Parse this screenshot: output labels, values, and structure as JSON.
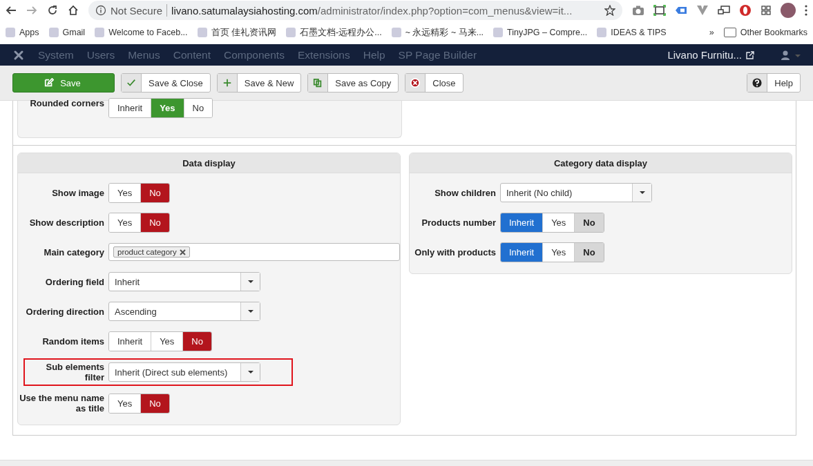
{
  "browser": {
    "security": "Not Secure",
    "url_host": "livano.satumalaysiahosting.com",
    "url_path": "/administrator/index.php?option=com_menus&view=it...",
    "bookmarks": [
      {
        "label": "Apps"
      },
      {
        "label": "Gmail"
      },
      {
        "label": "Welcome to Faceb..."
      },
      {
        "label": "首页 佳礼资讯网"
      },
      {
        "label": "石墨文档-远程办公..."
      },
      {
        "label": "~ 永远精彩 ~ 马来..."
      },
      {
        "label": "TinyJPG – Compre..."
      },
      {
        "label": "IDEAS & TIPS"
      }
    ],
    "overflow": "»",
    "other_bookmarks": "Other Bookmarks"
  },
  "nav": {
    "menu": [
      "System",
      "Users",
      "Menus",
      "Content",
      "Components",
      "Extensions",
      "Help",
      "SP Page Builder"
    ],
    "site_link": "Livano Furnitu..."
  },
  "toolbar": [
    {
      "label": "Save",
      "kind": "save"
    },
    {
      "label": "Save & Close",
      "kind": "check"
    },
    {
      "label": "Save & New",
      "kind": "plus"
    },
    {
      "label": "Save as Copy",
      "kind": "copy"
    },
    {
      "label": "Close",
      "kind": "close"
    }
  ],
  "help_button": "Help",
  "top_panel": {
    "fields": [
      {
        "label": "Rounded corners",
        "kind": "toggle",
        "options": [
          {
            "label": "Inherit",
            "kind": "inherit",
            "selected": false,
            "pressed": false
          },
          {
            "label": "Yes",
            "kind": "yes",
            "selected": true,
            "pressed": false
          },
          {
            "label": "No",
            "kind": "no",
            "selected": false,
            "pressed": false
          }
        ]
      }
    ]
  },
  "panels": [
    {
      "title": "Data display",
      "fields": [
        {
          "label": "Show image",
          "kind": "toggle",
          "options": [
            {
              "label": "Yes",
              "kind": "yes",
              "selected": false,
              "pressed": false
            },
            {
              "label": "No",
              "kind": "no",
              "selected": true,
              "pressed": false
            }
          ]
        },
        {
          "label": "Show description",
          "kind": "toggle",
          "options": [
            {
              "label": "Yes",
              "kind": "yes",
              "selected": false,
              "pressed": false
            },
            {
              "label": "No",
              "kind": "no",
              "selected": true,
              "pressed": false
            }
          ]
        },
        {
          "label": "Main category",
          "kind": "tags",
          "tags": [
            "product category"
          ]
        },
        {
          "label": "Ordering field",
          "kind": "select",
          "value": "Inherit"
        },
        {
          "label": "Ordering direction",
          "kind": "select",
          "value": "Ascending"
        },
        {
          "label": "Random items",
          "kind": "toggle",
          "options": [
            {
              "label": "Inherit",
              "kind": "inherit",
              "selected": false,
              "pressed": false
            },
            {
              "label": "Yes",
              "kind": "yes",
              "selected": false,
              "pressed": false
            },
            {
              "label": "No",
              "kind": "no",
              "selected": true,
              "pressed": false
            }
          ]
        },
        {
          "label": "Sub elements filter",
          "kind": "select",
          "value": "Inherit (Direct sub elements)",
          "highlighted": true
        },
        {
          "label": "Use the menu name as title",
          "kind": "toggle",
          "options": [
            {
              "label": "Yes",
              "kind": "yes",
              "selected": false,
              "pressed": false
            },
            {
              "label": "No",
              "kind": "no",
              "selected": true,
              "pressed": false
            }
          ]
        }
      ]
    },
    {
      "title": "Category data display",
      "fields": [
        {
          "label": "Show children",
          "kind": "select",
          "value": "Inherit (No child)"
        },
        {
          "label": "Products number",
          "kind": "toggle",
          "options": [
            {
              "label": "Inherit",
              "kind": "inherit",
              "selected": true,
              "pressed": false
            },
            {
              "label": "Yes",
              "kind": "yes",
              "selected": false,
              "pressed": false
            },
            {
              "label": "No",
              "kind": "no",
              "selected": false,
              "pressed": true
            }
          ]
        },
        {
          "label": "Only with products",
          "kind": "toggle",
          "options": [
            {
              "label": "Inherit",
              "kind": "inherit",
              "selected": true,
              "pressed": false
            },
            {
              "label": "Yes",
              "kind": "yes",
              "selected": false,
              "pressed": false
            },
            {
              "label": "No",
              "kind": "no",
              "selected": false,
              "pressed": true
            }
          ]
        }
      ]
    }
  ]
}
